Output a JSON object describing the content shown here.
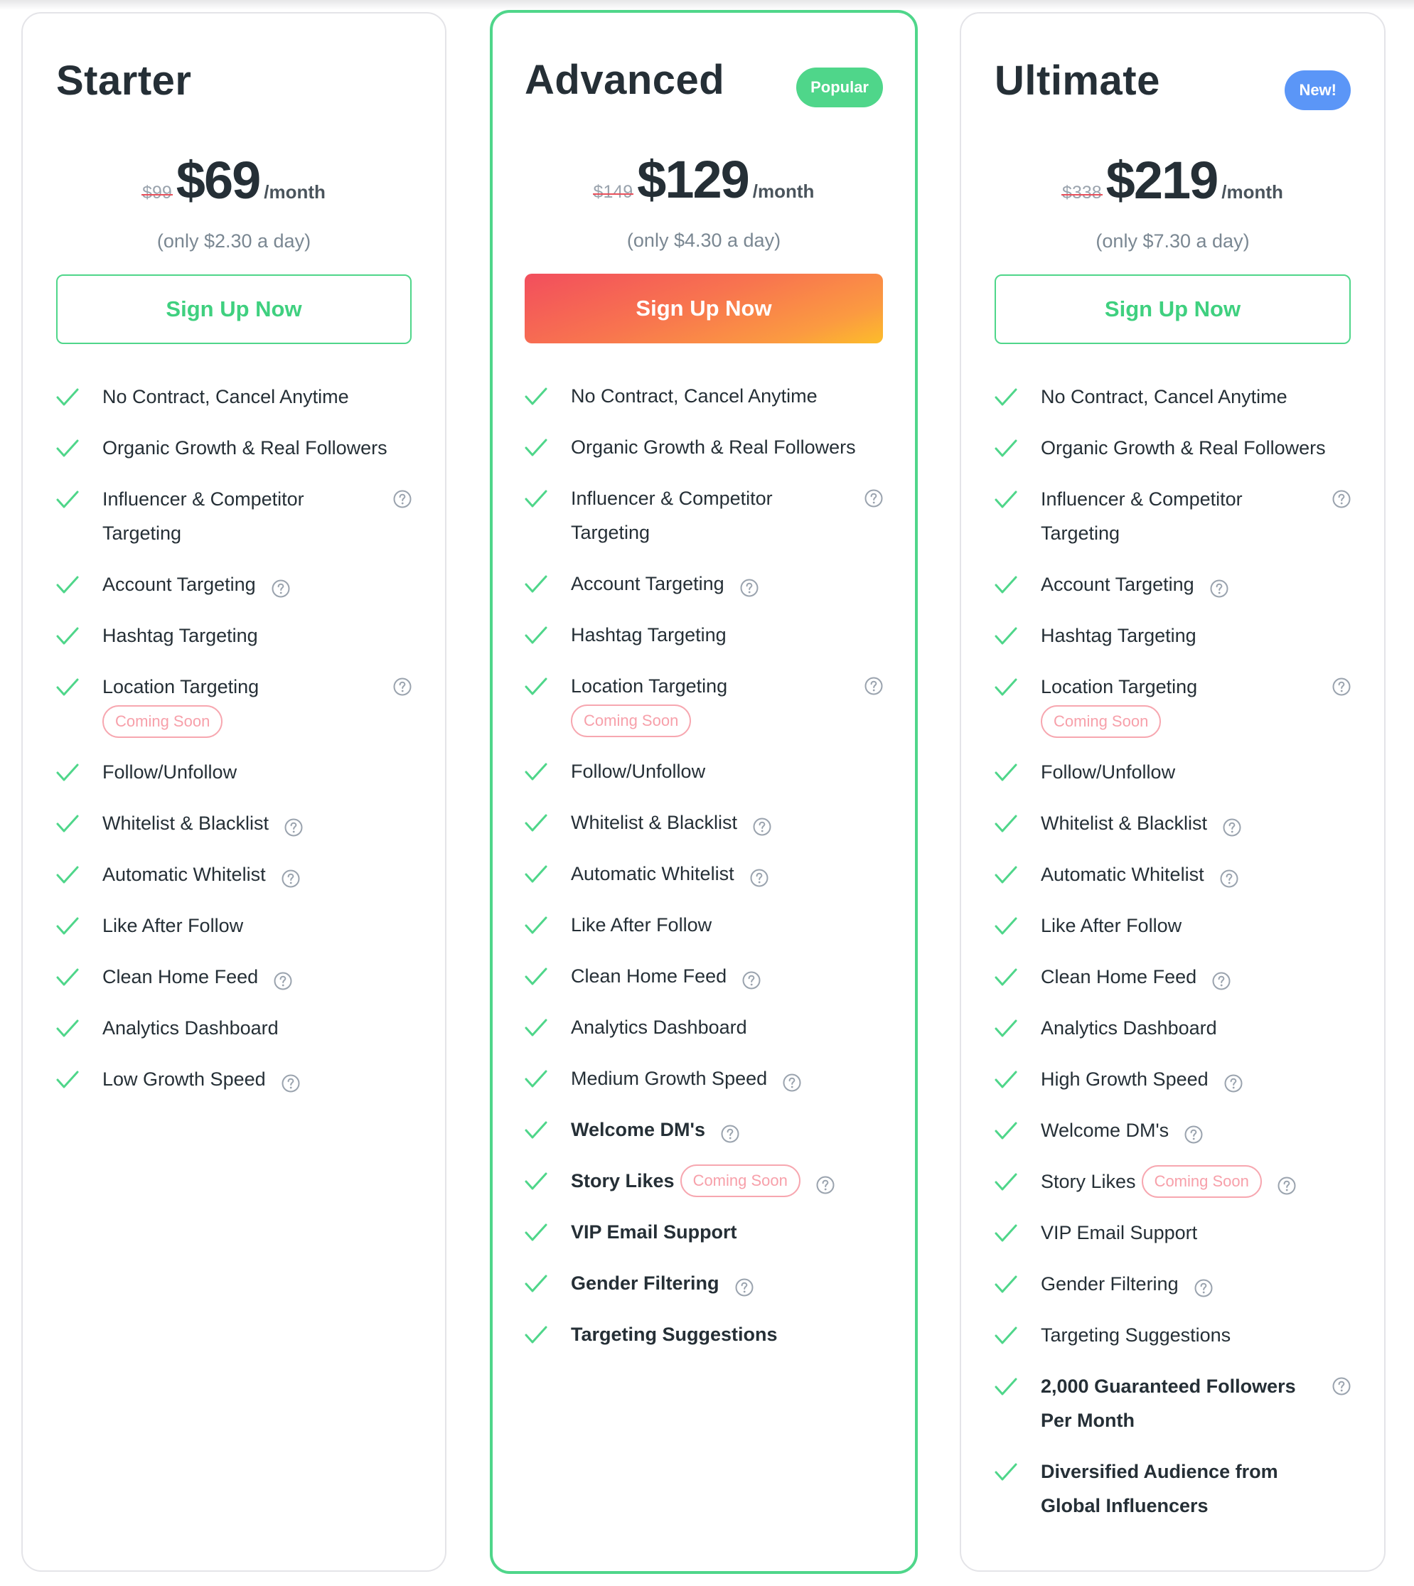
{
  "colors": {
    "accent_green": "#4fd68a",
    "badge_popular": "#4fd68a",
    "badge_new": "#5b96f7",
    "coming_soon": "#f7a0aa",
    "strike": "#e8505b",
    "text_dark": "#252f36",
    "text_muted": "#7a8792"
  },
  "common": {
    "coming_soon_label": "Coming Soon",
    "per_month": "/month"
  },
  "plans": [
    {
      "name": "Starter",
      "badge": null,
      "old_price": "$99",
      "price": "$69",
      "per": "/month",
      "daily": "(only $2.30 a day)",
      "cta": "Sign Up Now",
      "cta_style": "outline",
      "features": [
        {
          "text": "No Contract, Cancel Anytime"
        },
        {
          "text": "Organic Growth & Real Followers"
        },
        {
          "text": "Influencer & Competitor Targeting",
          "help": true,
          "help_right": true,
          "wrap": true
        },
        {
          "text": "Account Targeting",
          "help": true
        },
        {
          "text": "Hashtag Targeting"
        },
        {
          "text": "Location Targeting",
          "help": true,
          "help_right": true,
          "soon": "Coming Soon",
          "soon_below": true
        },
        {
          "text": "Follow/Unfollow"
        },
        {
          "text": "Whitelist & Blacklist",
          "help": true
        },
        {
          "text": "Automatic Whitelist",
          "help": true
        },
        {
          "text": "Like After Follow"
        },
        {
          "text": "Clean Home Feed",
          "help": true
        },
        {
          "text": "Analytics Dashboard"
        },
        {
          "text": "Low Growth Speed",
          "help": true
        }
      ]
    },
    {
      "name": "Advanced",
      "badge": "Popular",
      "badge_color": "#4fd68a",
      "featured": true,
      "old_price": "$149",
      "price": "$129",
      "per": "/month",
      "daily": "(only $4.30 a day)",
      "cta": "Sign Up Now",
      "cta_style": "filled",
      "features": [
        {
          "text": "No Contract, Cancel Anytime"
        },
        {
          "text": "Organic Growth & Real Followers"
        },
        {
          "text": "Influencer & Competitor Targeting",
          "help": true,
          "help_right": true,
          "wrap": true
        },
        {
          "text": "Account Targeting",
          "help": true
        },
        {
          "text": "Hashtag Targeting"
        },
        {
          "text": "Location Targeting",
          "help": true,
          "help_right": true,
          "soon": "Coming Soon",
          "soon_below": true
        },
        {
          "text": "Follow/Unfollow"
        },
        {
          "text": "Whitelist & Blacklist",
          "help": true
        },
        {
          "text": "Automatic Whitelist",
          "help": true
        },
        {
          "text": "Like After Follow"
        },
        {
          "text": "Clean Home Feed",
          "help": true
        },
        {
          "text": "Analytics Dashboard"
        },
        {
          "text": "Medium Growth Speed",
          "help": true
        },
        {
          "text": "Welcome DM's",
          "help": true,
          "bold": true
        },
        {
          "text": "Story Likes",
          "help": true,
          "bold": true,
          "soon": "Coming Soon"
        },
        {
          "text": "VIP Email Support",
          "bold": true
        },
        {
          "text": "Gender Filtering",
          "help": true,
          "bold": true
        },
        {
          "text": "Targeting Suggestions",
          "bold": true
        }
      ]
    },
    {
      "name": "Ultimate",
      "badge": "New!",
      "badge_color": "#5b96f7",
      "old_price": "$338",
      "price": "$219",
      "per": "/month",
      "daily": "(only $7.30 a day)",
      "cta": "Sign Up Now",
      "cta_style": "outline",
      "features": [
        {
          "text": "No Contract, Cancel Anytime"
        },
        {
          "text": "Organic Growth & Real Followers"
        },
        {
          "text": "Influencer & Competitor Targeting",
          "help": true,
          "help_right": true,
          "wrap": true
        },
        {
          "text": "Account Targeting",
          "help": true
        },
        {
          "text": "Hashtag Targeting"
        },
        {
          "text": "Location Targeting",
          "help": true,
          "help_right": true,
          "soon": "Coming Soon",
          "soon_below": true
        },
        {
          "text": "Follow/Unfollow"
        },
        {
          "text": "Whitelist & Blacklist",
          "help": true
        },
        {
          "text": "Automatic Whitelist",
          "help": true
        },
        {
          "text": "Like After Follow"
        },
        {
          "text": "Clean Home Feed",
          "help": true
        },
        {
          "text": "Analytics Dashboard"
        },
        {
          "text": "High Growth Speed",
          "help": true
        },
        {
          "text": "Welcome DM's",
          "help": true
        },
        {
          "text": "Story Likes",
          "help": true,
          "soon": "Coming Soon"
        },
        {
          "text": "VIP Email Support"
        },
        {
          "text": "Gender Filtering",
          "help": true
        },
        {
          "text": "Targeting Suggestions"
        },
        {
          "text": "2,000 Guaranteed Followers Per Month",
          "help": true,
          "help_right": true,
          "bold": true,
          "wrap": true
        },
        {
          "text": "Diversified Audience from Global Influencers",
          "bold": true,
          "wrap": true,
          "wide": true
        }
      ]
    }
  ]
}
